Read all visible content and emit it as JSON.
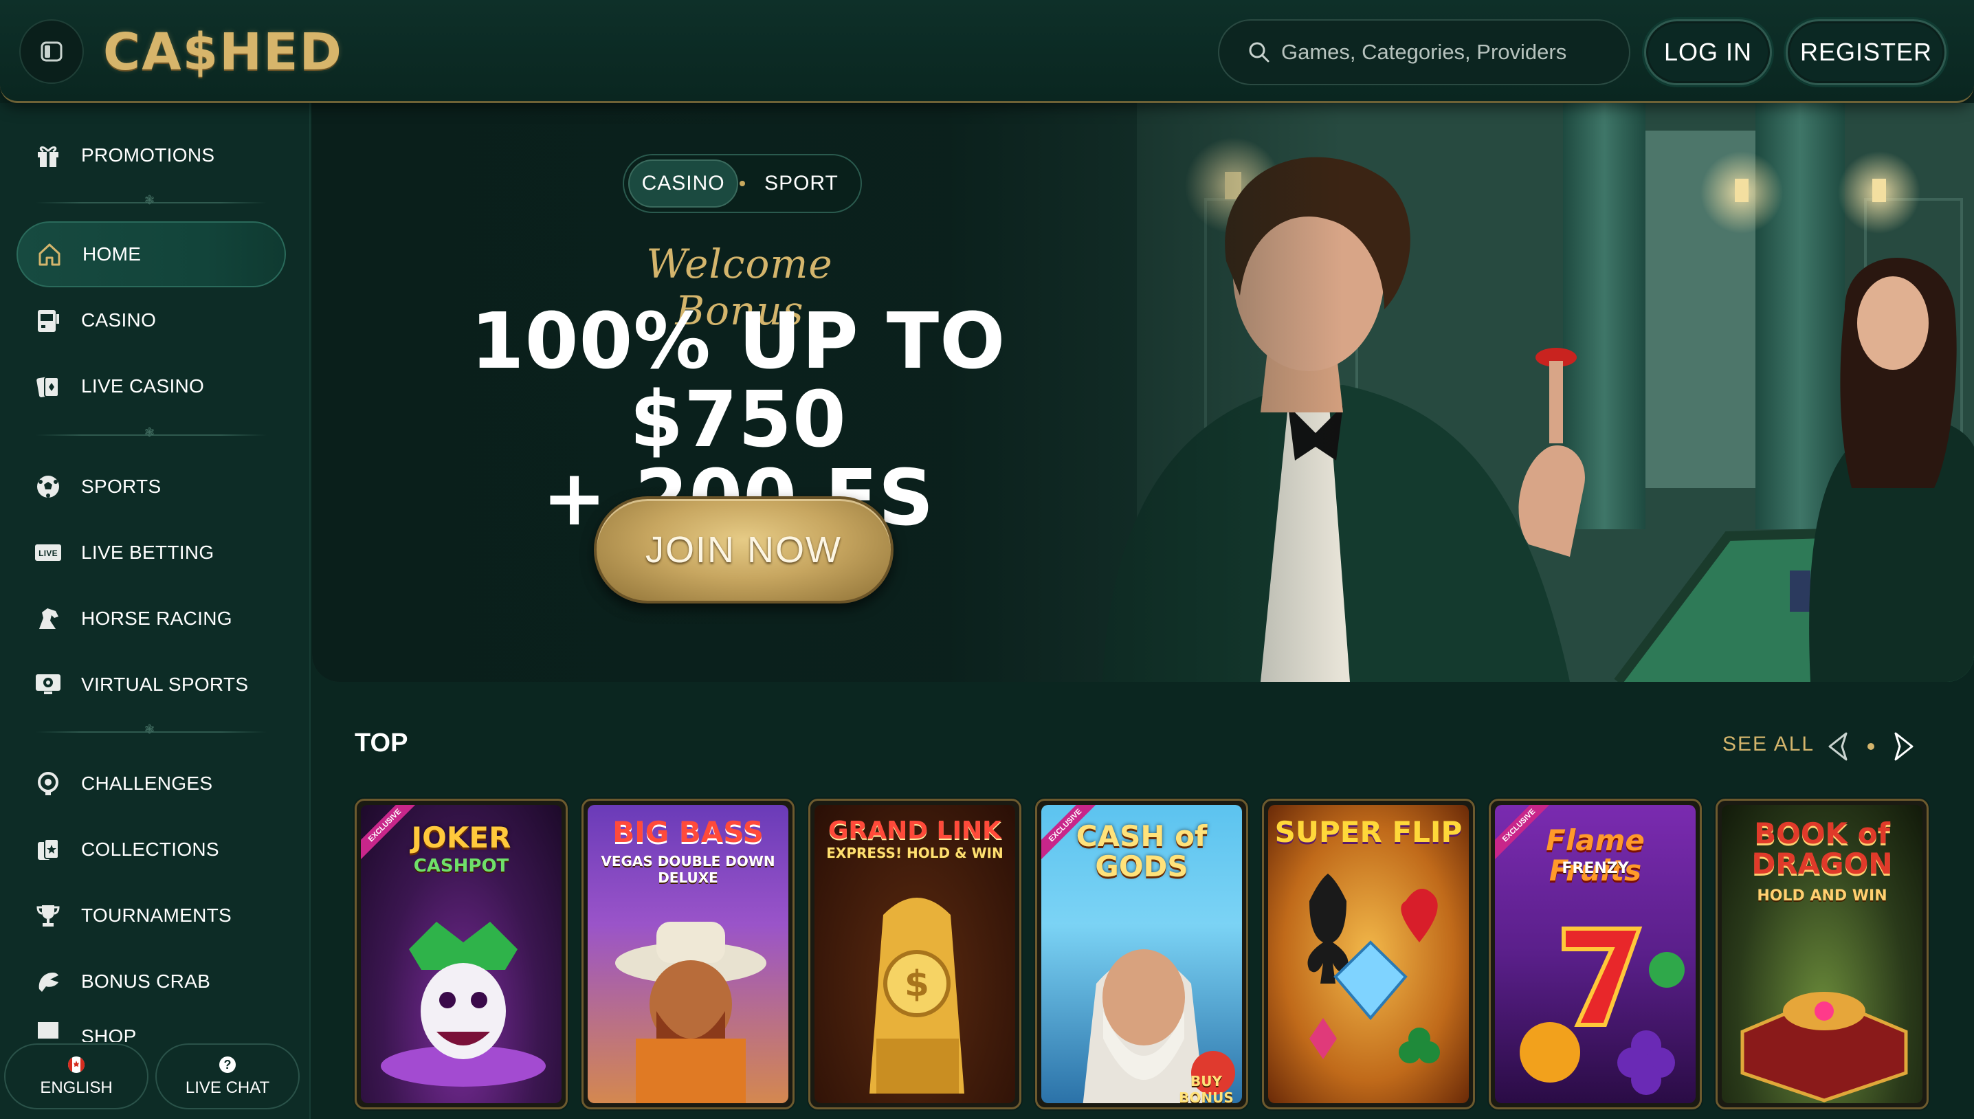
{
  "header": {
    "logo": "CA$HED",
    "search_placeholder": "Games, Categories, Providers",
    "login_label": "LOG IN",
    "register_label": "REGISTER"
  },
  "sidebar": {
    "items": [
      {
        "label": "PROMOTIONS",
        "icon": "gift-icon"
      },
      {
        "label": "HOME",
        "icon": "home-icon",
        "active": true
      },
      {
        "label": "CASINO",
        "icon": "slot-machine-icon"
      },
      {
        "label": "LIVE CASINO",
        "icon": "cards-icon"
      },
      {
        "label": "SPORTS",
        "icon": "soccer-ball-icon"
      },
      {
        "label": "LIVE BETTING",
        "icon": "live-icon"
      },
      {
        "label": "HORSE RACING",
        "icon": "horse-icon"
      },
      {
        "label": "VIRTUAL SPORTS",
        "icon": "monitor-ball-icon"
      },
      {
        "label": "CHALLENGES",
        "icon": "target-icon"
      },
      {
        "label": "COLLECTIONS",
        "icon": "card-collection-icon"
      },
      {
        "label": "TOURNAMENTS",
        "icon": "trophy-icon"
      },
      {
        "label": "BONUS CRAB",
        "icon": "crab-claw-icon"
      },
      {
        "label": "SHOP",
        "icon": "shop-icon"
      }
    ],
    "language_label": "ENGLISH",
    "live_chat_label": "LIVE CHAT"
  },
  "hero": {
    "toggle": [
      "CASINO",
      "SPORT"
    ],
    "welcome": "Welcome Bonus",
    "headline_line1": "100% UP TO $750",
    "headline_line2": "+ 200 FS",
    "cta": "JOIN NOW"
  },
  "top_section": {
    "title": "TOP",
    "see_all": "SEE ALL",
    "games": [
      {
        "title": "JOKER",
        "subtitle": "CASHPOT",
        "exclusive": true,
        "exclusive_label": "EXCLUSIVE"
      },
      {
        "title": "BIG BASS",
        "subtitle": "VEGAS DOUBLE DOWN DELUXE",
        "exclusive": false
      },
      {
        "title": "GRAND LINK",
        "subtitle": "EXPRESS! HOLD & WIN",
        "exclusive": false
      },
      {
        "title": "CASH of GODS",
        "subtitle": "BUY BONUS",
        "exclusive": true,
        "exclusive_label": "EXCLUSIVE"
      },
      {
        "title": "SUPER FLIP",
        "subtitle": "",
        "exclusive": false
      },
      {
        "title": "Flame Fruits",
        "subtitle": "FRENZY",
        "exclusive": true,
        "exclusive_label": "EXCLUSIVE"
      },
      {
        "title": "BOOK of DRAGON",
        "subtitle": "HOLD AND WIN",
        "exclusive": false
      }
    ]
  },
  "colors": {
    "background": "#0b2620",
    "gold": "#d4b56c",
    "active_nav": "#174a40"
  }
}
